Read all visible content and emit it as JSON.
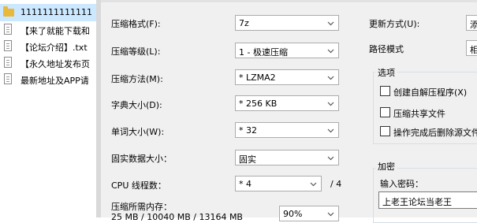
{
  "file_list": [
    {
      "name": "1111111111111",
      "icon": "folder-icon",
      "selected": true
    },
    {
      "name": "【来了就能下载和",
      "icon": "document-icon"
    },
    {
      "name": "【论坛介绍】.txt",
      "icon": "document-icon"
    },
    {
      "name": "【永久地址发布页",
      "icon": "document-icon"
    },
    {
      "name": "最新地址及APP请",
      "icon": "document-icon"
    }
  ],
  "form": {
    "format": {
      "label": "压缩格式(F):",
      "value": "7z"
    },
    "level": {
      "label": "压缩等级(L):",
      "value": "1 - 极速压缩"
    },
    "method": {
      "label": "压缩方法(M):",
      "value": "* LZMA2"
    },
    "dict_size": {
      "label": "字典大小(D):",
      "value": "* 256 KB"
    },
    "word_size": {
      "label": "单词大小(W):",
      "value": "* 32"
    },
    "solid_block": {
      "label": "固实数据大小：",
      "value": "固实"
    },
    "cpu_threads": {
      "label": "CPU 线程数：",
      "value": "* 4",
      "max": "/ 4"
    },
    "memory": {
      "label": "压缩所需内存：",
      "detail": "25 MB / 10040 MB / 13164 MB",
      "percent": "90%"
    }
  },
  "right": {
    "update_mode": {
      "label": "更新方式(U):",
      "value": "添"
    },
    "path_mode": {
      "label": "路径模式",
      "value": "相"
    },
    "options": {
      "title": "选项",
      "items": [
        {
          "label": "创建自解压程序(X)",
          "checked": false
        },
        {
          "label": "压缩共享文件",
          "checked": false
        },
        {
          "label": "操作完成后删除源文件",
          "checked": false
        }
      ]
    },
    "encryption": {
      "title": "加密",
      "password_label": "输入密码：",
      "password_value": "上老王论坛当老王"
    }
  }
}
